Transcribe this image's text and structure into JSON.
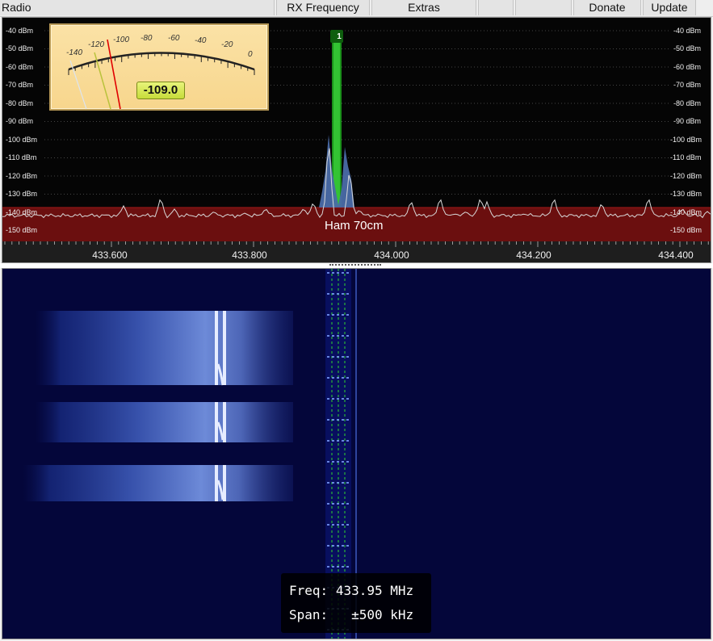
{
  "menu": {
    "radio": "Radio",
    "rx_frequency": "RX Frequency",
    "extras": "Extras",
    "blank1": "",
    "blank2": "",
    "donate": "Donate",
    "update": "Update"
  },
  "spectrum": {
    "db_labels": [
      "-40 dBm",
      "-50 dBm",
      "-60 dBm",
      "-70 dBm",
      "-80 dBm",
      "-90 dBm",
      "-100 dBm",
      "-110 dBm",
      "-120 dBm",
      "-130 dBm",
      "-140 dBm",
      "-150 dBm"
    ],
    "freq_labels": [
      "433.600",
      "433.800",
      "434.000",
      "434.200",
      "434.400"
    ],
    "band_name": "Ham 70cm",
    "channel_marker": "1",
    "colors": {
      "band_fill": "#6b0f0f",
      "channel": "#22c022",
      "trace": "#d8d8d8",
      "signal_fill": "#4a6ca8"
    }
  },
  "smeter": {
    "scale": [
      "-140",
      "-120",
      "-100",
      "-80",
      "-60",
      "-40",
      "-20",
      "0"
    ],
    "value": "-109.0"
  },
  "info": {
    "freq_label": "Freq:",
    "freq_value": "433.95 MHz",
    "span_label": "Span:",
    "span_value": "±500 kHz"
  }
}
